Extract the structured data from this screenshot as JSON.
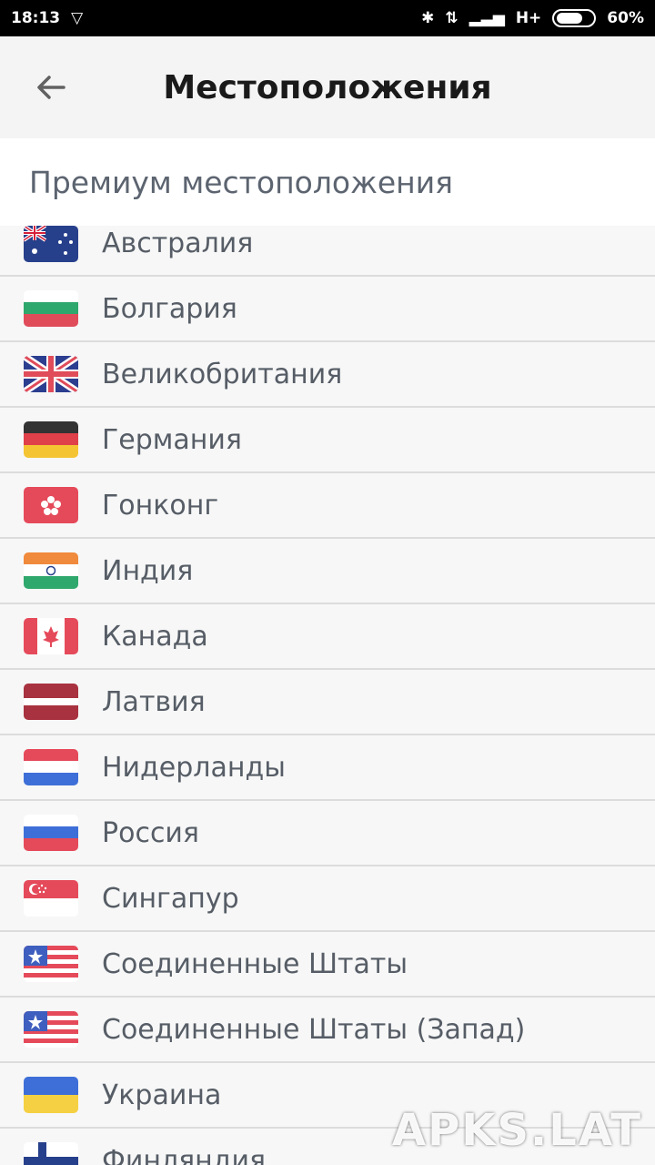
{
  "status": {
    "time": "18:13",
    "network": "H+",
    "battery": "60%"
  },
  "header": {
    "title": "Местоположения"
  },
  "section": {
    "title": "Премиум местоположения"
  },
  "countries": [
    {
      "name": "Австралия",
      "icon": "australia-flag-icon"
    },
    {
      "name": "Болгария",
      "icon": "bulgaria-flag-icon"
    },
    {
      "name": "Великобритания",
      "icon": "uk-flag-icon"
    },
    {
      "name": "Германия",
      "icon": "germany-flag-icon"
    },
    {
      "name": "Гонконг",
      "icon": "hong-kong-flag-icon"
    },
    {
      "name": "Индия",
      "icon": "india-flag-icon"
    },
    {
      "name": "Канада",
      "icon": "canada-flag-icon"
    },
    {
      "name": "Латвия",
      "icon": "latvia-flag-icon"
    },
    {
      "name": "Нидерланды",
      "icon": "netherlands-flag-icon"
    },
    {
      "name": "Россия",
      "icon": "russia-flag-icon"
    },
    {
      "name": "Сингапур",
      "icon": "singapore-flag-icon"
    },
    {
      "name": "Соединенные Штаты",
      "icon": "usa-flag-icon"
    },
    {
      "name": "Соединенные Штаты (Запад)",
      "icon": "usa-flag-icon"
    },
    {
      "name": "Украина",
      "icon": "ukraine-flag-icon"
    },
    {
      "name": "Финляндия",
      "icon": "finland-flag-icon"
    }
  ],
  "watermark": "APKS.LAT"
}
